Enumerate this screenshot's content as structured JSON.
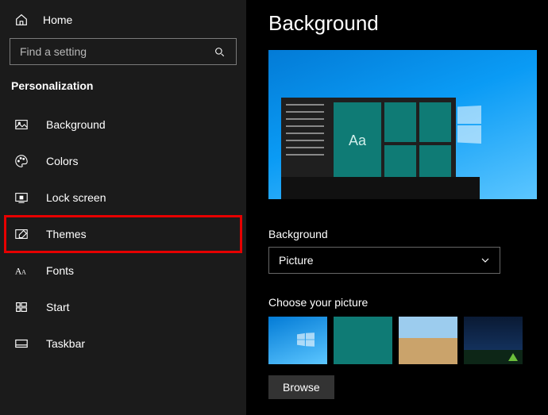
{
  "sidebar": {
    "home": "Home",
    "search_placeholder": "Find a setting",
    "section": "Personalization",
    "items": [
      {
        "label": "Background"
      },
      {
        "label": "Colors"
      },
      {
        "label": "Lock screen"
      },
      {
        "label": "Themes"
      },
      {
        "label": "Fonts"
      },
      {
        "label": "Start"
      },
      {
        "label": "Taskbar"
      }
    ],
    "highlighted_index": 3
  },
  "main": {
    "title": "Background",
    "dropdown_label": "Background",
    "dropdown_value": "Picture",
    "choose_label": "Choose your picture",
    "browse_label": "Browse",
    "preview_tile_text": "Aa"
  }
}
